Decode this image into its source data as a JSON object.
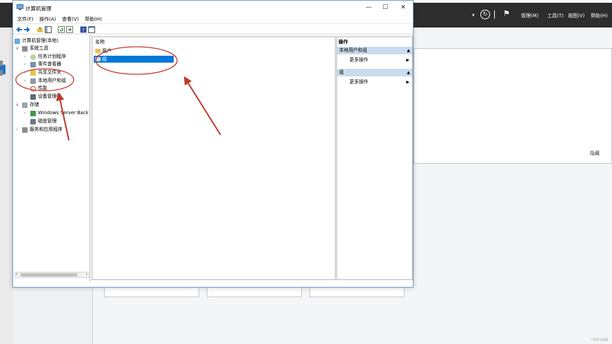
{
  "background": {
    "menu": [
      "管理(M)",
      "工具(T)",
      "视图(V)",
      "帮助(H)"
    ],
    "hide_label": "隐藏",
    "footer_text": "CSDN @某某"
  },
  "window": {
    "title": "计算机管理",
    "min_glyph": "—",
    "max_glyph": "☐",
    "close_glyph": "✕"
  },
  "menubar": [
    "文件(F)",
    "操作(A)",
    "查看(V)",
    "帮助(H)"
  ],
  "tree": {
    "root": "计算机管理(本地)",
    "system_tools": "系统工具",
    "task_scheduler": "任务计划程序",
    "event_viewer": "事件查看器",
    "shared_folders": "共享文件夹",
    "local_users_groups": "本地用户和组",
    "performance": "性能",
    "device_manager": "设备管理器",
    "storage": "存储",
    "windows_server_backup": "Windows Server Back",
    "disk_management": "磁盘管理",
    "services_apps": "服务和应用程序"
  },
  "list": {
    "header": "名称",
    "rows": [
      "用户",
      "组"
    ],
    "selected_index": 1
  },
  "actions": {
    "title": "操作",
    "section1": "本地用户和组",
    "section2": "组",
    "more": "更多操作"
  },
  "colors": {
    "selection": "#0078d7",
    "annotation": "#c0392b",
    "action_section": "#c9dbee"
  }
}
